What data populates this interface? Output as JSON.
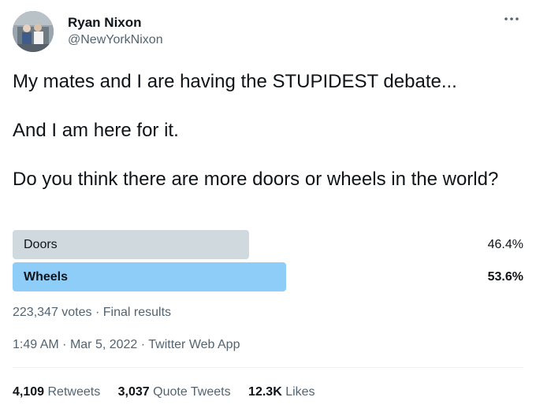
{
  "author": {
    "name": "Ryan Nixon",
    "handle": "@NewYorkNixon"
  },
  "tweet": {
    "line1": "My mates and I are having the STUPIDEST debate...",
    "line2": "And I am here for it.",
    "line3": "Do you think there are more doors or wheels in the world?"
  },
  "poll": {
    "options": [
      {
        "label": "Doors",
        "percent_text": "46.4%",
        "percent": 46.4,
        "bar_color": "#cfd9de",
        "winner": false
      },
      {
        "label": "Wheels",
        "percent_text": "53.6%",
        "percent": 53.6,
        "bar_color": "#8ecdf8",
        "winner": true
      }
    ],
    "votes": "223,347 votes",
    "separator": "·",
    "status": "Final results"
  },
  "timestamp": {
    "time": "1:49 AM",
    "date": "Mar 5, 2022",
    "source": "Twitter Web App",
    "separator": "·"
  },
  "stats": {
    "retweets_count": "4,109",
    "retweets_label": "Retweets",
    "quotes_count": "3,037",
    "quotes_label": "Quote Tweets",
    "likes_count": "12.3K",
    "likes_label": "Likes"
  },
  "icons": {
    "more": "more-dots-icon"
  }
}
